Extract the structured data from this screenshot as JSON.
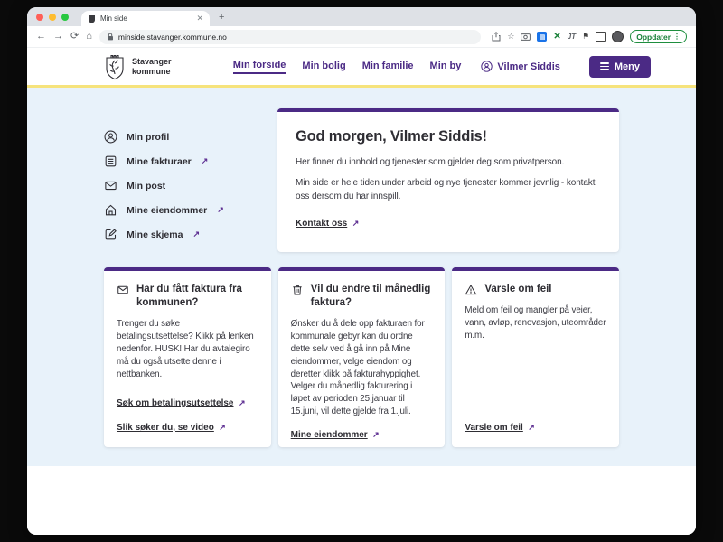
{
  "browser": {
    "tab_title": "Min side",
    "url": "minside.stavanger.kommune.no",
    "update_label": "Oppdater",
    "jt_ext_label": "JT"
  },
  "header": {
    "logo_line1": "Stavanger",
    "logo_line2": "kommune",
    "nav": [
      {
        "label": "Min forside",
        "active": true
      },
      {
        "label": "Min bolig",
        "active": false
      },
      {
        "label": "Min familie",
        "active": false
      },
      {
        "label": "Min by",
        "active": false
      }
    ],
    "user_name": "Vilmer Siddis",
    "menu_button": "Meny"
  },
  "sidebar": {
    "items": [
      {
        "label": "Min profil",
        "icon": "person-icon",
        "external": false
      },
      {
        "label": "Mine fakturaer",
        "icon": "invoice-icon",
        "external": true
      },
      {
        "label": "Min post",
        "icon": "mail-icon",
        "external": false
      },
      {
        "label": "Mine eiendommer",
        "icon": "home-icon",
        "external": true
      },
      {
        "label": "Mine skjema",
        "icon": "form-icon",
        "external": true
      }
    ]
  },
  "main_card": {
    "title": "God morgen, Vilmer Siddis!",
    "paragraph1": "Her finner du innhold og tjenester som gjelder deg som privatperson.",
    "paragraph2": "Min side er hele tiden under arbeid og nye tjenester kommer jevnlig - kontakt oss dersom du har innspill.",
    "link": "Kontakt oss"
  },
  "cards": [
    {
      "icon": "mail-icon",
      "title": "Har du fått faktura fra kommunen?",
      "body": "Trenger du søke betalingsutsettelse? Klikk på lenken nedenfor. HUSK! Har du avtalegiro må du også utsette denne i nettbanken.",
      "links": [
        "Søk om betalingsutsettelse",
        "Slik søker du, se video"
      ]
    },
    {
      "icon": "trash-icon",
      "title": "Vil du endre til månedlig faktura?",
      "body": "Ønsker du å dele opp fakturaen for kommunale gebyr kan du ordne dette selv ved å gå inn på Mine eiendommer, velge eiendom og deretter klikk på fakturahyppighet. Velger du månedlig fakturering i løpet av perioden 25.januar til 15.juni, vil dette gjelde fra 1.juli.",
      "links": [
        "Mine eiendommer"
      ]
    },
    {
      "icon": "warning-icon",
      "title": "Varsle om feil",
      "body": "Meld om feil og mangler på veier, vann, avløp, renovasjon, uteområder m.m.",
      "links": [
        "Varsle om feil"
      ]
    }
  ],
  "colors": {
    "brand_purple": "#4b2a85",
    "accent_yellow": "#f6e37c",
    "content_bg": "#e8f2fa",
    "link_arrow_purple": "#5c2d91",
    "update_green": "#188038",
    "text_dark": "#2e2d33"
  }
}
